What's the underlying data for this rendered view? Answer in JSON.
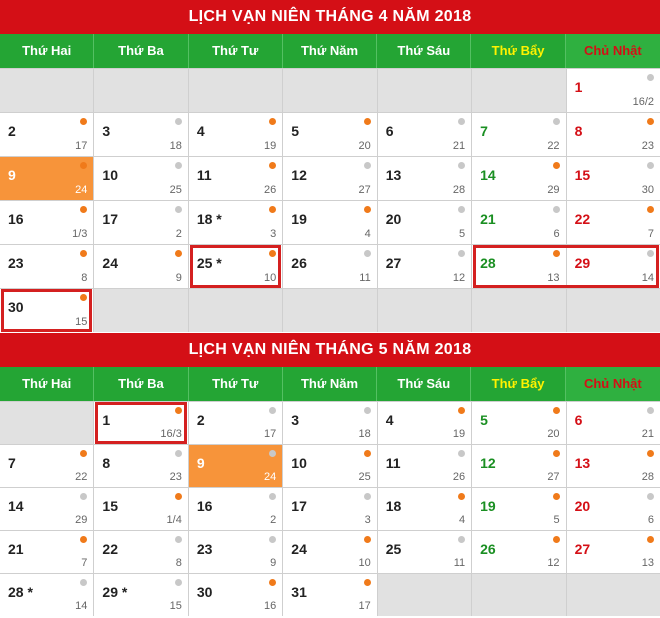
{
  "weekdays": [
    "Thứ Hai",
    "Thứ Ba",
    "Thứ Tư",
    "Thứ Năm",
    "Thứ Sáu",
    "Thứ Bẩy",
    "Chủ Nhật"
  ],
  "colors": {
    "title_bg": "#d40f16",
    "header_bg": "#24a534",
    "saturday": "#1a8f22",
    "sunday": "#d40f16",
    "today": "#f7943a",
    "highlight": "#d42020",
    "dot_orange": "#f07a1a",
    "dot_gray": "#c8c8c8"
  },
  "april": {
    "title": "LỊCH VẠN NIÊN THÁNG 4 NĂM 2018",
    "lead_empty": 6,
    "days": [
      {
        "d": "1",
        "l": "16/2",
        "dot": "gray"
      },
      {
        "d": "2",
        "l": "17",
        "dot": "orange"
      },
      {
        "d": "3",
        "l": "18",
        "dot": "gray"
      },
      {
        "d": "4",
        "l": "19",
        "dot": "orange"
      },
      {
        "d": "5",
        "l": "20",
        "dot": "orange"
      },
      {
        "d": "6",
        "l": "21",
        "dot": "gray"
      },
      {
        "d": "7",
        "l": "22",
        "dot": "gray"
      },
      {
        "d": "8",
        "l": "23",
        "dot": "orange"
      },
      {
        "d": "9",
        "l": "24",
        "dot": "orange",
        "today": true
      },
      {
        "d": "10",
        "l": "25",
        "dot": "gray"
      },
      {
        "d": "11",
        "l": "26",
        "dot": "orange"
      },
      {
        "d": "12",
        "l": "27",
        "dot": "gray"
      },
      {
        "d": "13",
        "l": "28",
        "dot": "gray"
      },
      {
        "d": "14",
        "l": "29",
        "dot": "orange"
      },
      {
        "d": "15",
        "l": "30",
        "dot": "gray"
      },
      {
        "d": "16",
        "l": "1/3",
        "dot": "orange"
      },
      {
        "d": "17",
        "l": "2",
        "dot": "gray"
      },
      {
        "d": "18 *",
        "l": "3",
        "dot": "orange"
      },
      {
        "d": "19",
        "l": "4",
        "dot": "orange"
      },
      {
        "d": "20",
        "l": "5",
        "dot": "gray"
      },
      {
        "d": "21",
        "l": "6",
        "dot": "gray"
      },
      {
        "d": "22",
        "l": "7",
        "dot": "orange"
      },
      {
        "d": "23",
        "l": "8",
        "dot": "orange"
      },
      {
        "d": "24",
        "l": "9",
        "dot": "orange"
      },
      {
        "d": "25 *",
        "l": "10",
        "dot": "orange",
        "highlight": true
      },
      {
        "d": "26",
        "l": "11",
        "dot": "gray"
      },
      {
        "d": "27",
        "l": "12",
        "dot": "gray"
      },
      {
        "d": "28",
        "l": "13",
        "dot": "orange",
        "highlight": true
      },
      {
        "d": "29",
        "l": "14",
        "dot": "gray",
        "highlight": true
      },
      {
        "d": "30",
        "l": "15",
        "dot": "orange",
        "highlight": true
      }
    ]
  },
  "may": {
    "title": "LỊCH VẠN NIÊN THÁNG 5 NĂM 2018",
    "lead_empty": 1,
    "days": [
      {
        "d": "1",
        "l": "16/3",
        "dot": "orange",
        "highlight": true
      },
      {
        "d": "2",
        "l": "17",
        "dot": "gray"
      },
      {
        "d": "3",
        "l": "18",
        "dot": "gray"
      },
      {
        "d": "4",
        "l": "19",
        "dot": "orange"
      },
      {
        "d": "5",
        "l": "20",
        "dot": "orange"
      },
      {
        "d": "6",
        "l": "21",
        "dot": "gray"
      },
      {
        "d": "7",
        "l": "22",
        "dot": "orange"
      },
      {
        "d": "8",
        "l": "23",
        "dot": "gray"
      },
      {
        "d": "9",
        "l": "24",
        "dot": "gray",
        "today": true
      },
      {
        "d": "10",
        "l": "25",
        "dot": "orange"
      },
      {
        "d": "11",
        "l": "26",
        "dot": "gray"
      },
      {
        "d": "12",
        "l": "27",
        "dot": "orange"
      },
      {
        "d": "13",
        "l": "28",
        "dot": "orange"
      },
      {
        "d": "14",
        "l": "29",
        "dot": "gray"
      },
      {
        "d": "15",
        "l": "1/4",
        "dot": "orange"
      },
      {
        "d": "16",
        "l": "2",
        "dot": "gray"
      },
      {
        "d": "17",
        "l": "3",
        "dot": "gray"
      },
      {
        "d": "18",
        "l": "4",
        "dot": "orange"
      },
      {
        "d": "19",
        "l": "5",
        "dot": "orange"
      },
      {
        "d": "20",
        "l": "6",
        "dot": "gray"
      },
      {
        "d": "21",
        "l": "7",
        "dot": "orange"
      },
      {
        "d": "22",
        "l": "8",
        "dot": "gray"
      },
      {
        "d": "23",
        "l": "9",
        "dot": "gray"
      },
      {
        "d": "24",
        "l": "10",
        "dot": "orange"
      },
      {
        "d": "25",
        "l": "11",
        "dot": "gray"
      },
      {
        "d": "26",
        "l": "12",
        "dot": "orange"
      },
      {
        "d": "27",
        "l": "13",
        "dot": "orange"
      },
      {
        "d": "28 *",
        "l": "14",
        "dot": "gray"
      },
      {
        "d": "29 *",
        "l": "15",
        "dot": "gray"
      },
      {
        "d": "30",
        "l": "16",
        "dot": "orange"
      },
      {
        "d": "31",
        "l": "17",
        "dot": "orange"
      }
    ]
  }
}
